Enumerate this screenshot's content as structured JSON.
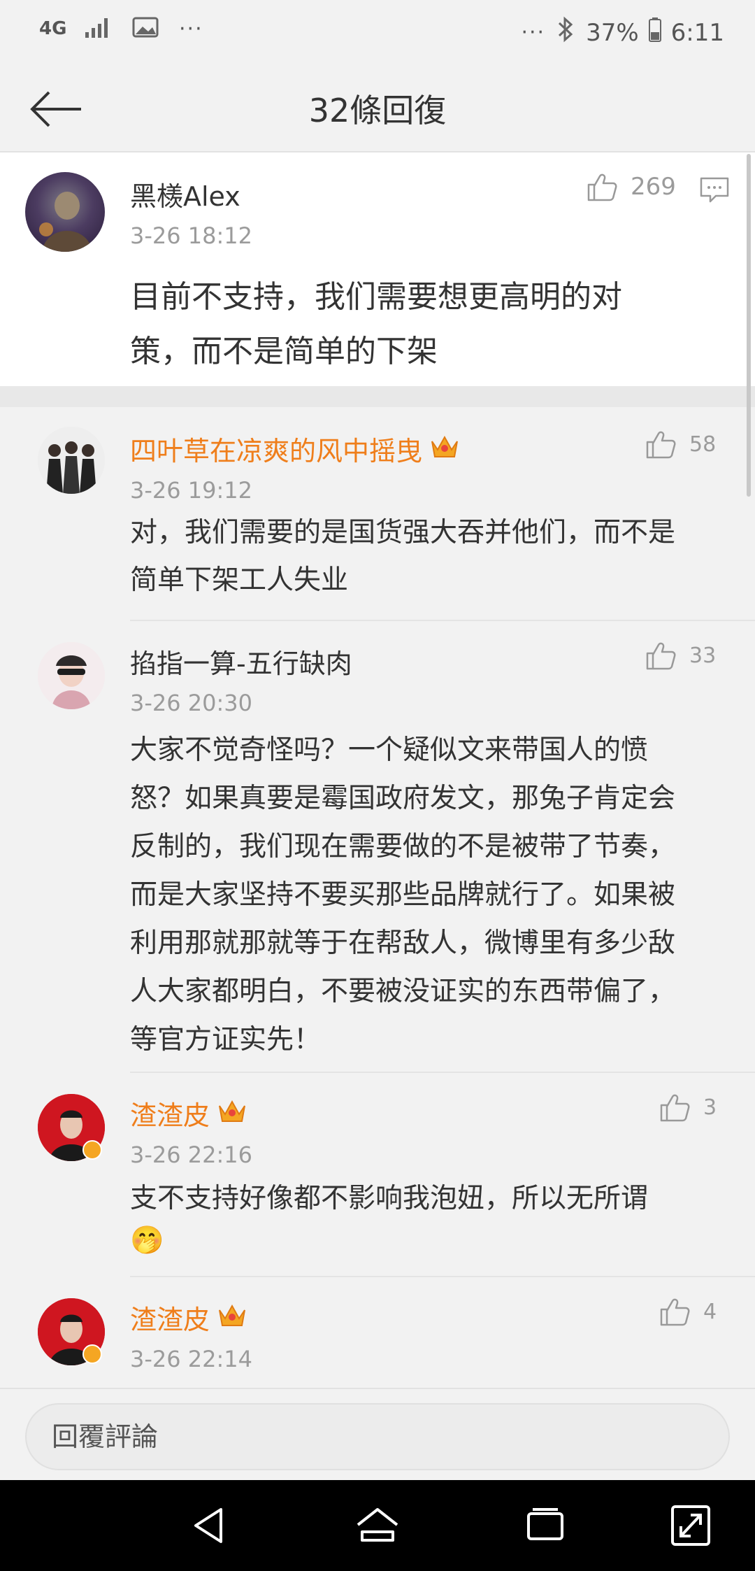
{
  "status_bar": {
    "network": "4G",
    "more_left": "···",
    "more_right": "···",
    "battery": "37%",
    "time": "6:11"
  },
  "header": {
    "title": "32條回復"
  },
  "main_comment": {
    "name": "黑檨Alex",
    "time": "3-26 18:12",
    "likes": "269",
    "text_line1": "目前不支持，我们需要想更高明的对",
    "text_line2": "策，而不是简单的下架"
  },
  "replies": [
    {
      "name": "四叶草在凉爽的风中摇曳",
      "time": "3-26 19:12",
      "likes": "58",
      "lines": [
        "对，我们需要的是国货强大吞并他们，而不是",
        "简单下架工人失业"
      ]
    },
    {
      "name": "掐指一算-五行缺肉",
      "time": "3-26 20:30",
      "likes": "33",
      "lines": [
        "大家不觉奇怪吗？一个疑似文来带国人的愤",
        "怒？如果真要是霉国政府发文，那兔子肯定会",
        "反制的，我们现在需要做的不是被带了节奏，",
        "而是大家坚持不要买那些品牌就行了。如果被",
        "利用那就那就等于在帮敌人，微博里有多少敌",
        "人大家都明白，不要被没证实的东西带偏了，",
        "等官方证实先！"
      ]
    },
    {
      "name": "渣渣皮",
      "time": "3-26 22:16",
      "likes": "3",
      "lines": [
        "支不支持好像都不影响我泡妞，所以无所谓"
      ],
      "emoji": "🤭"
    },
    {
      "name": "渣渣皮",
      "time": "3-26 22:14",
      "likes": "4"
    }
  ],
  "reply_input": {
    "placeholder": "回覆評論"
  },
  "colors": {
    "vip_name": "#ef7e1b",
    "muted": "#9b9b9b",
    "background": "#f2f2f2"
  }
}
